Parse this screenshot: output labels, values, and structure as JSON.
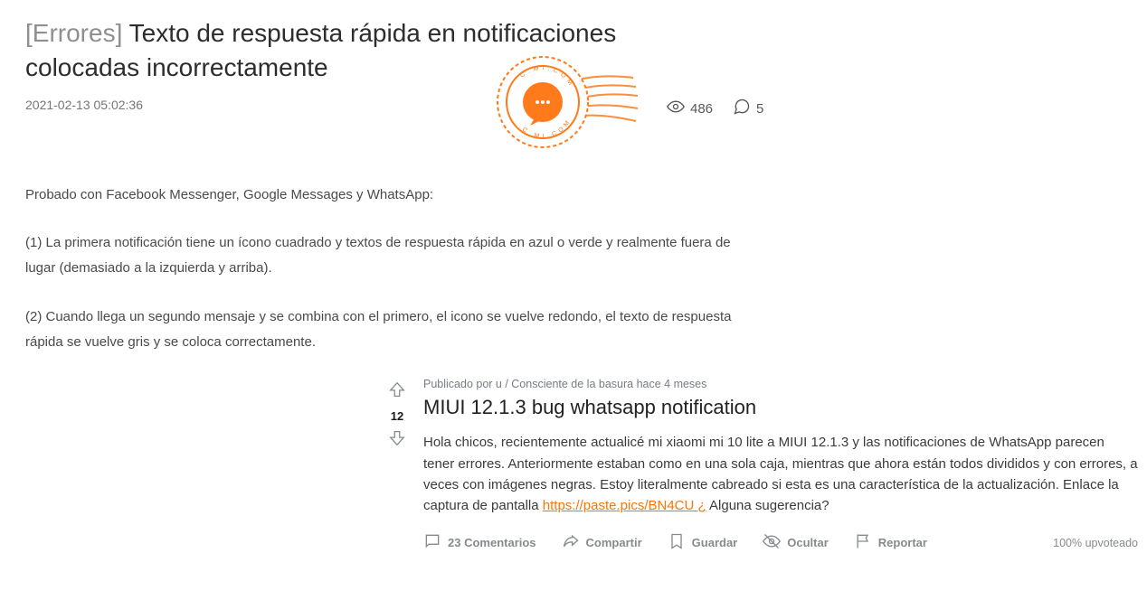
{
  "post": {
    "tag": "[Errores]",
    "title": "Texto de respuesta rápida en notificaciones colocadas incorrectamente",
    "timestamp": "2021-02-13 05:02:36",
    "views": "486",
    "comments": "5",
    "para1": "Probado con Facebook Messenger, Google Messages y WhatsApp:",
    "para2": "(1) La primera notificación tiene un ícono cuadrado y textos de respuesta rápida en azul o verde y realmente fuera de lugar (demasiado a la izquierda y arriba).",
    "para3": "(2) Cuando llega un segundo mensaje y se combina con el primero, el icono se vuelve redondo, el texto de respuesta rápida se vuelve gris y se coloca correctamente."
  },
  "card": {
    "score": "12",
    "byline": "Publicado por u / Consciente de la basura hace 4 meses",
    "title": "MIUI 12.1.3 bug whatsapp notification",
    "body_before_link": "Hola chicos, recientemente actualicé mi xiaomi mi 10 lite a MIUI 12.1.3 y las notificaciones de WhatsApp parecen tener errores. Anteriormente estaban como en una sola caja, mientras que ahora están todos divididos y con errores, a veces con imágenes negras. Estoy literalmente cabreado si esta es una característica de la actualización. Enlace la captura de pantalla ",
    "link_text": "https://paste.pics/BN4CU ¿",
    "body_after_link": " Alguna sugerencia?",
    "actions": {
      "comments": "23 Comentarios",
      "share": "Compartir",
      "save": "Guardar",
      "hide": "Ocultar",
      "report": "Reportar"
    },
    "upvote_pct": "100% upvoteado"
  }
}
